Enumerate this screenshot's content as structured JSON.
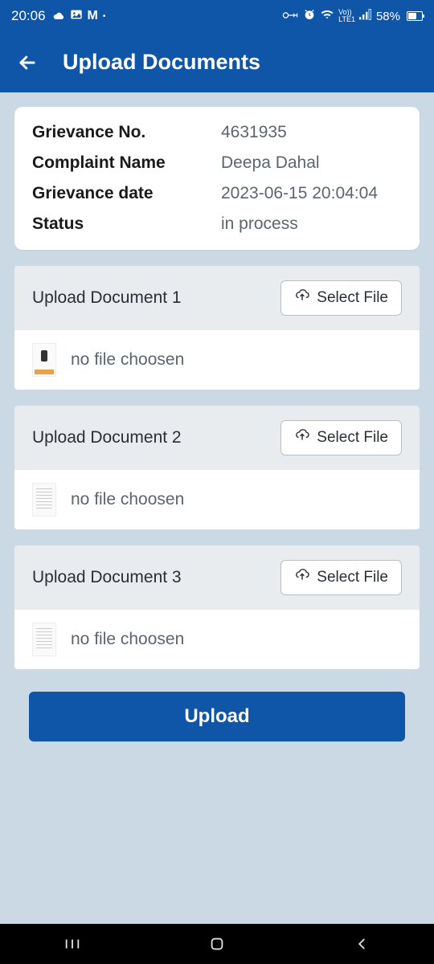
{
  "statusBar": {
    "time": "20:06",
    "batteryPercent": "58%"
  },
  "appBar": {
    "title": "Upload Documents"
  },
  "info": {
    "grievanceNoLabel": "Grievance No.",
    "grievanceNoValue": "4631935",
    "complaintNameLabel": "Complaint Name",
    "complaintNameValue": "Deepa Dahal",
    "grievanceDateLabel": "Grievance date",
    "grievanceDateValue": "2023-06-15 20:04:04",
    "statusLabel": "Status",
    "statusValue": "in process"
  },
  "uploads": [
    {
      "label": "Upload Document 1",
      "buttonLabel": "Select File",
      "fileStatus": "no file choosen"
    },
    {
      "label": "Upload Document 2",
      "buttonLabel": "Select File",
      "fileStatus": "no file choosen"
    },
    {
      "label": "Upload Document 3",
      "buttonLabel": "Select File",
      "fileStatus": "no file choosen"
    }
  ],
  "uploadButton": "Upload"
}
